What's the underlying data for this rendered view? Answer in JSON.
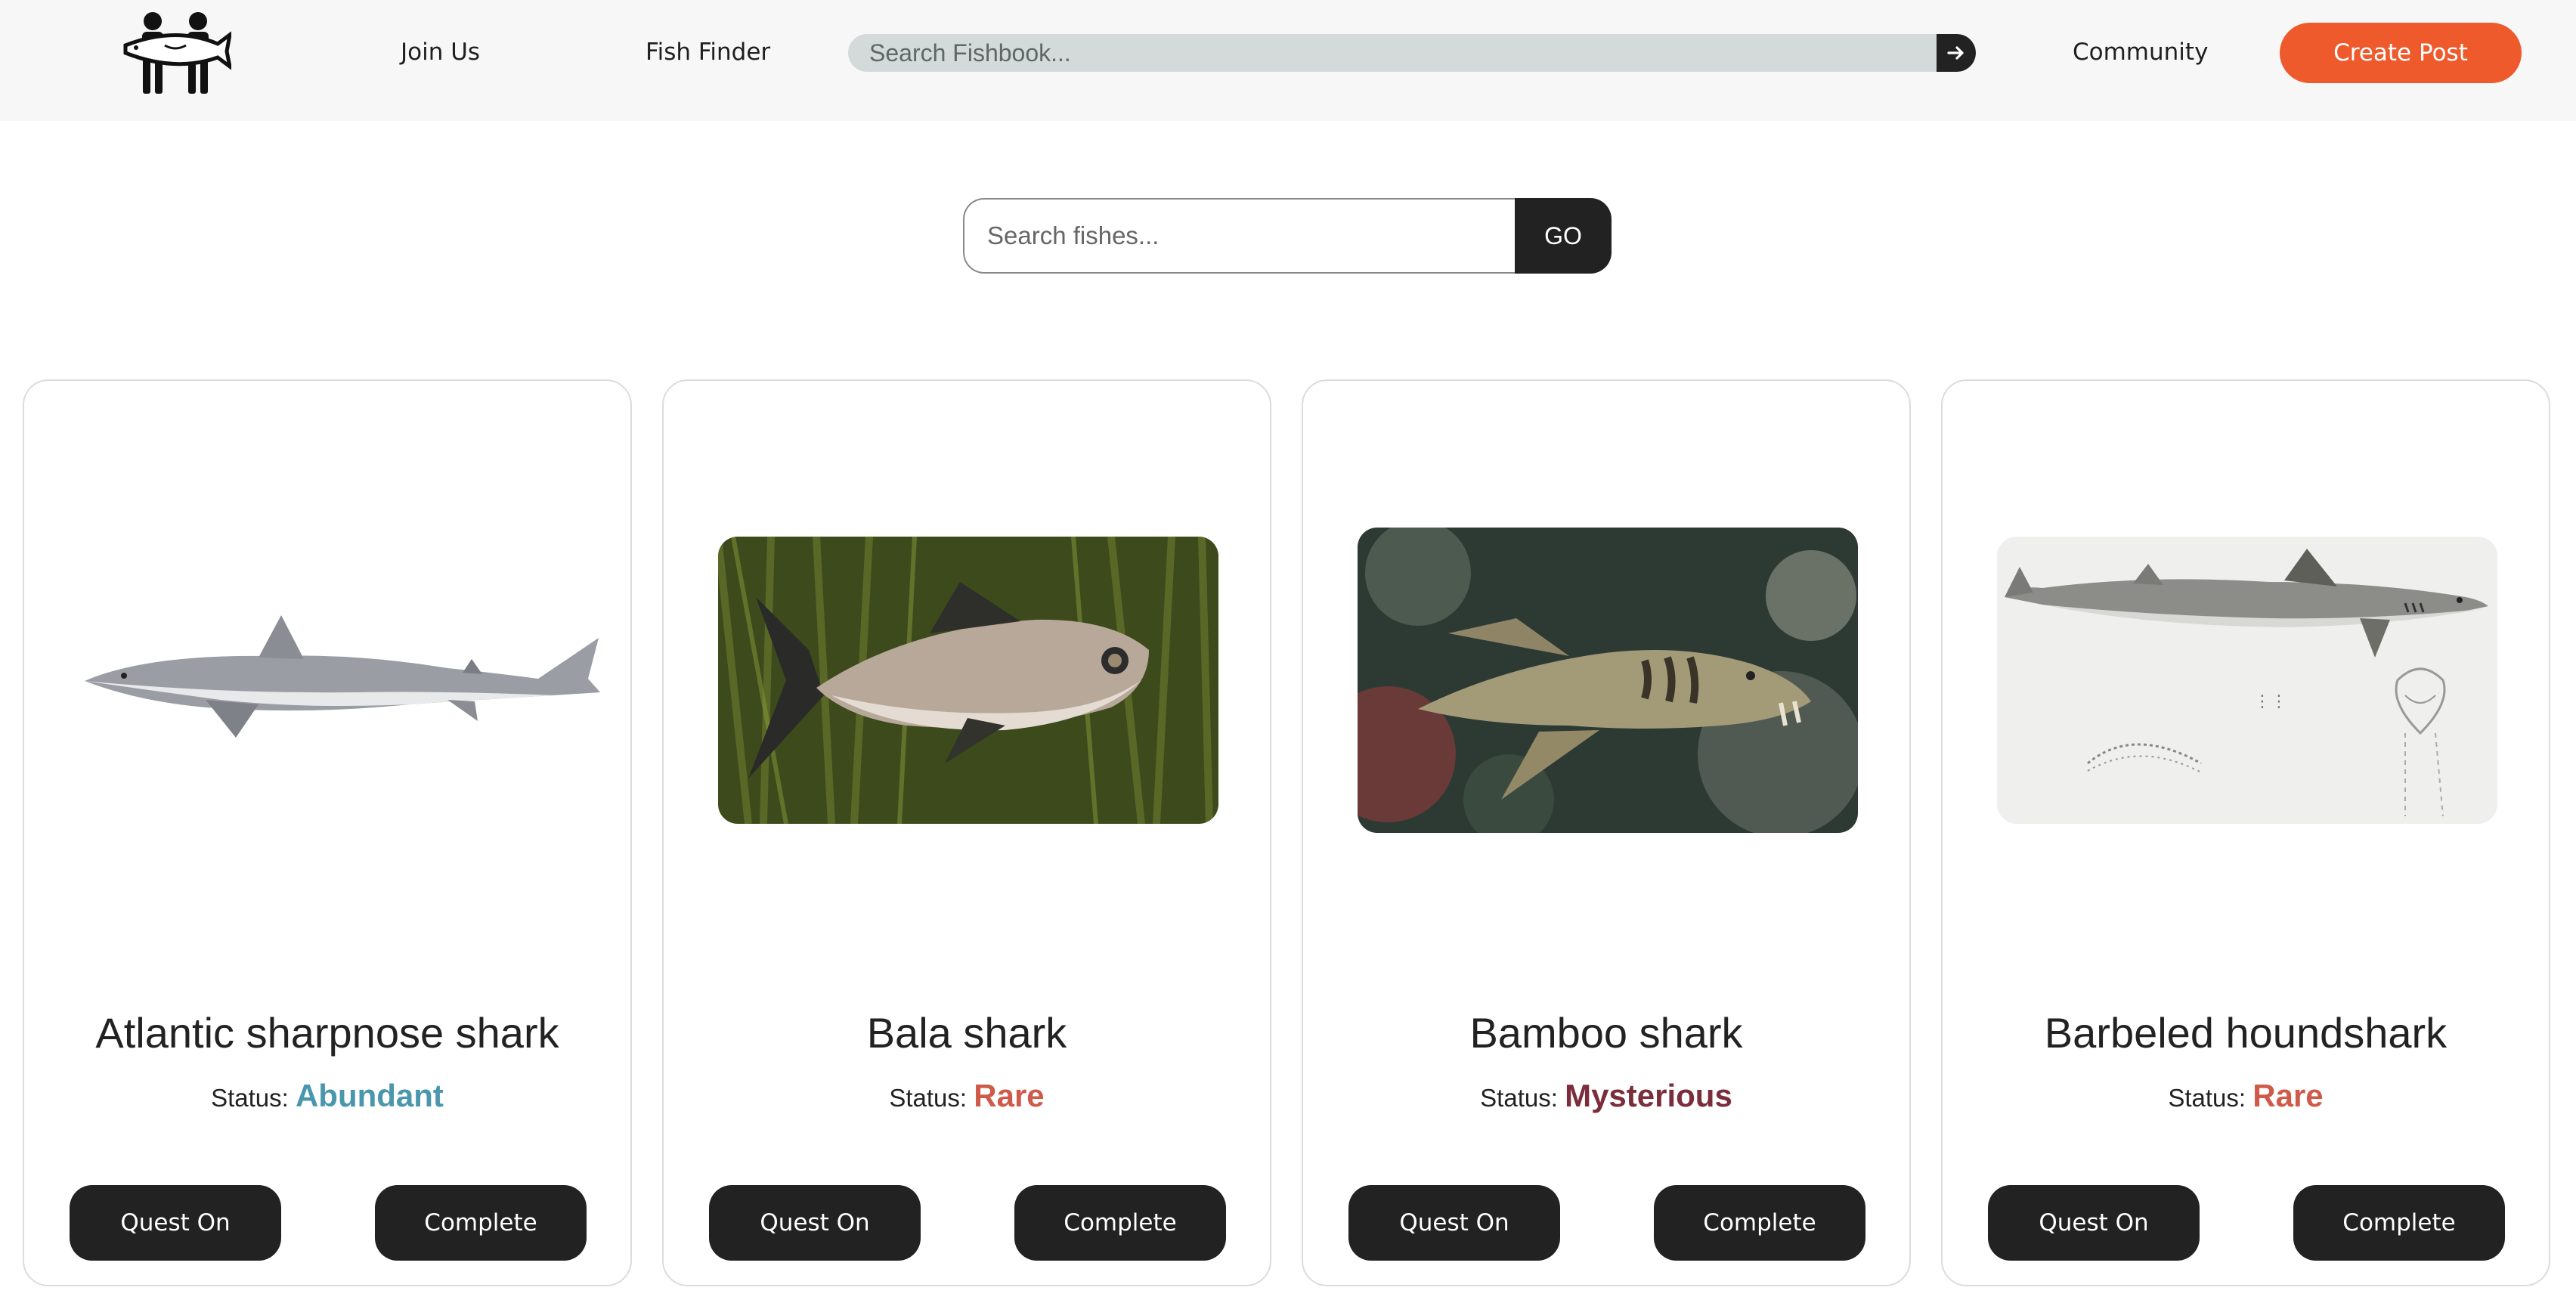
{
  "header": {
    "logo_alt": "Fishbook logo",
    "nav": {
      "join_us": "Join Us",
      "fish_finder": "Fish Finder",
      "community": "Community"
    },
    "search": {
      "placeholder": "Search Fishbook...",
      "value": "",
      "submit_icon": "arrow-right-icon"
    },
    "create_post": "Create Post"
  },
  "fish_search": {
    "placeholder": "Search fishes...",
    "value": "",
    "go_label": "GO"
  },
  "cards": [
    {
      "name": "Atlantic sharpnose shark",
      "status_label": "Status:",
      "status": "Abundant",
      "status_color": "#4a97ad",
      "quest_label": "Quest On",
      "complete_label": "Complete"
    },
    {
      "name": "Bala shark",
      "status_label": "Status:",
      "status": "Rare",
      "status_color": "#d05a4a",
      "quest_label": "Quest On",
      "complete_label": "Complete"
    },
    {
      "name": "Bamboo shark",
      "status_label": "Status:",
      "status": "Mysterious",
      "status_color": "#7a2d3a",
      "quest_label": "Quest On",
      "complete_label": "Complete"
    },
    {
      "name": "Barbeled houndshark",
      "status_label": "Status:",
      "status": "Rare",
      "status_color": "#d05a4a",
      "quest_label": "Quest On",
      "complete_label": "Complete"
    }
  ],
  "colors": {
    "accent": "#ee5a2c",
    "dark_button": "#222222",
    "header_bg": "#f7f7f7",
    "search_bg": "#d3dad9"
  }
}
